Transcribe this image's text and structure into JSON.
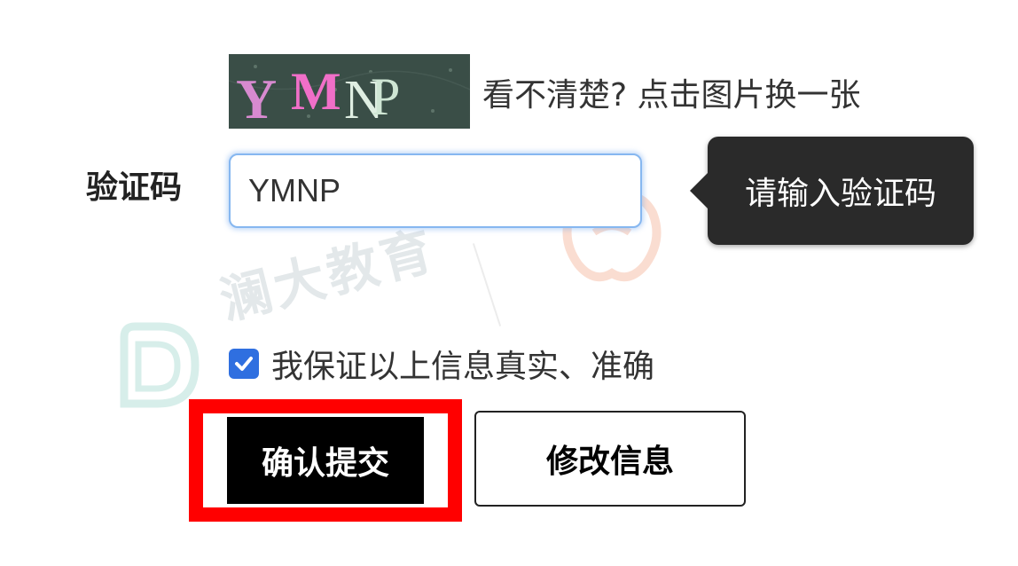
{
  "captcha": {
    "image_text": "YMNP",
    "letters": [
      {
        "char": "Y",
        "color": "#d88ad0"
      },
      {
        "char": "M",
        "color": "#f06fc8"
      },
      {
        "char": "N",
        "color": "#dfeee2"
      },
      {
        "char": "P",
        "color": "#cfe6d4"
      }
    ],
    "background_color": "#3a4e47",
    "refresh_hint": "看不清楚? 点击图片换一张"
  },
  "verification": {
    "label": "验证码",
    "value": "YMNP",
    "tooltip": "请输入验证码",
    "input_border_color": "#86b7f0"
  },
  "agreement": {
    "checked": true,
    "label": "我保证以上信息真实、准确",
    "checkbox_color": "#2f6fe0"
  },
  "actions": {
    "confirm_label": "确认提交",
    "modify_label": "修改信息",
    "highlight_color": "#ff0000"
  },
  "watermarks": {
    "left_text": "澜大教育",
    "left_icon": "leaf-logo-icon",
    "right_icon": "apple-logo-icon"
  }
}
